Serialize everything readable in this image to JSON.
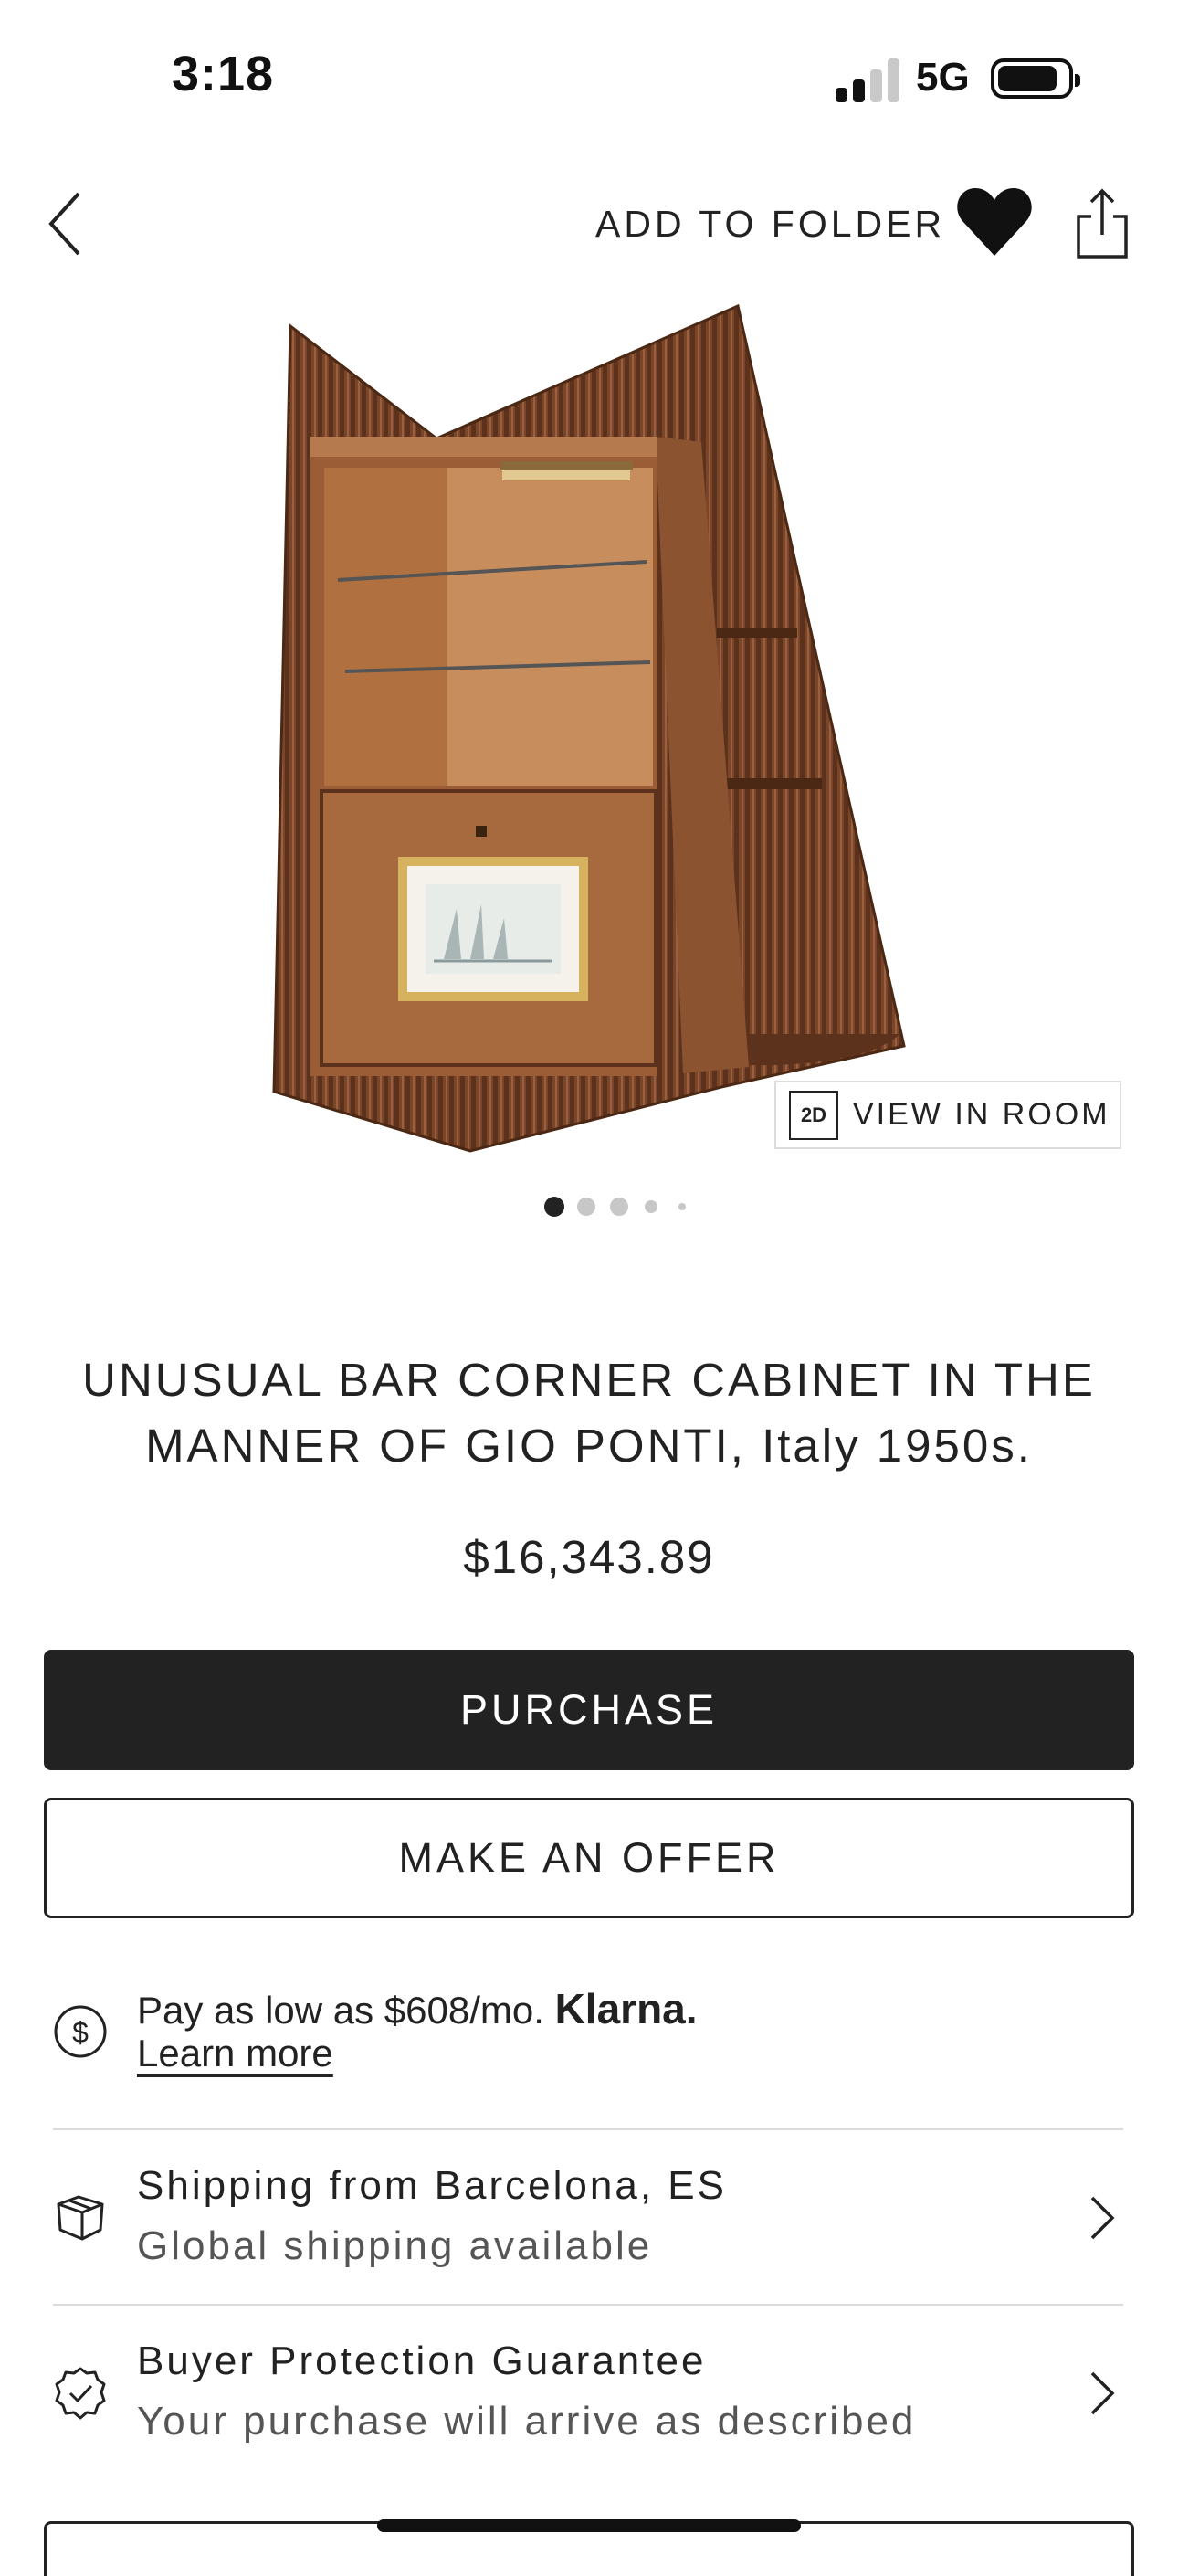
{
  "status_bar": {
    "time": "3:18",
    "network": "5G",
    "signal_bars": 2,
    "signal_bars_total": 4
  },
  "header": {
    "add_to_folder": "ADD TO FOLDER",
    "icons": [
      "back-chevron-icon",
      "heart-icon",
      "share-icon"
    ]
  },
  "gallery": {
    "view_in_room_badge": "2D",
    "view_in_room_label": "VIEW IN ROOM",
    "image_count": 5,
    "active_index": 0
  },
  "product": {
    "title": "UNUSUAL BAR CORNER CABINET IN THE MANNER OF GIO PONTI, Italy 1950s.",
    "price": "$16,343.89"
  },
  "actions": {
    "purchase": "PURCHASE",
    "make_offer": "MAKE AN OFFER"
  },
  "financing": {
    "text": "Pay as low as $608/mo.",
    "brand": "Klarna.",
    "link": "Learn more",
    "icon": "dollar-circle-icon"
  },
  "shipping": {
    "title": "Shipping from Barcelona, ES",
    "subtitle": "Global shipping available",
    "icon": "box-icon"
  },
  "protection": {
    "title": "Buyer Protection Guarantee",
    "subtitle": "Your purchase will arrive as described",
    "icon": "check-badge-icon"
  },
  "colors": {
    "primary_button": "#222222",
    "text": "#222222",
    "divider": "#dcdcdc",
    "wood": "#7a4528"
  }
}
